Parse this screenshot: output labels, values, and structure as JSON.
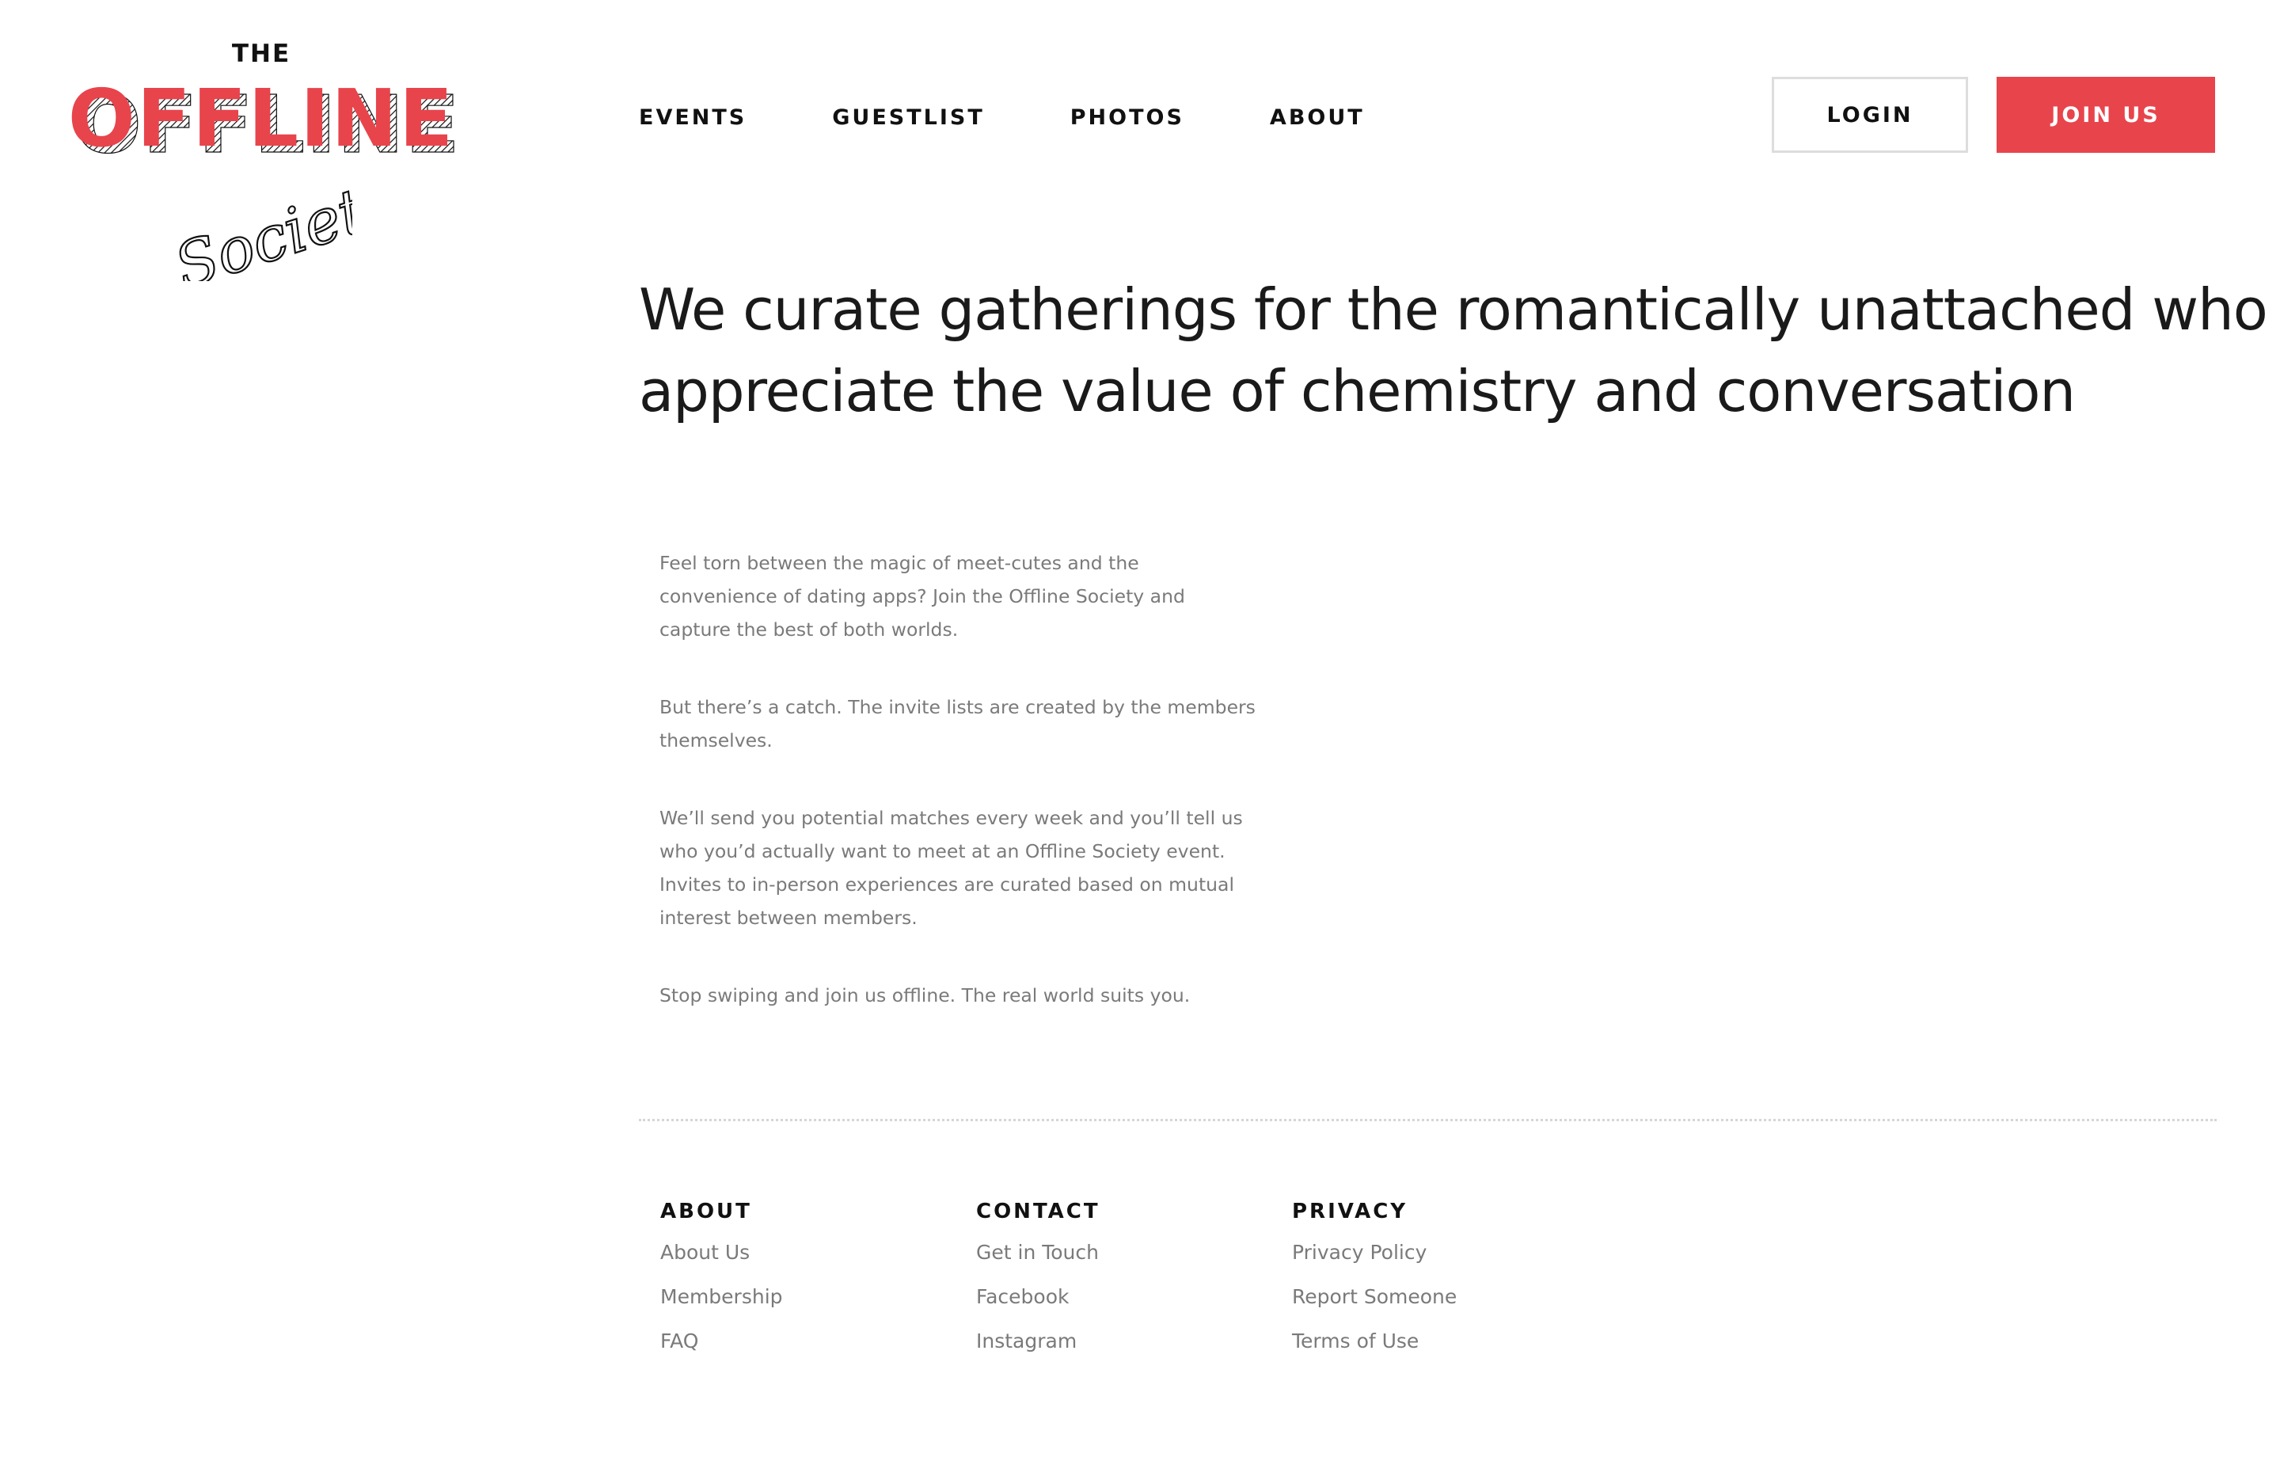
{
  "brand": {
    "logo_top": "THE",
    "logo_main": "OFFLINE",
    "logo_script": "Society",
    "accent_color": "#e8444c"
  },
  "nav": {
    "items": [
      {
        "label": "EVENTS"
      },
      {
        "label": "GUESTLIST"
      },
      {
        "label": "PHOTOS"
      },
      {
        "label": "ABOUT"
      }
    ],
    "login_label": "LOGIN",
    "join_label": "JOIN US"
  },
  "hero": {
    "line1": "We curate gatherings for the romantically unattached who",
    "line2": "appreciate the value of chemistry and conversation"
  },
  "body": {
    "paragraphs": [
      "Feel torn between the magic of meet-cutes and the convenience of dating apps? Join the Offline Society and capture the best of both worlds.",
      "But there’s a catch. The invite lists are created by the members themselves.",
      "We’ll send you potential matches every week and you’ll tell us who you’d actually want to meet at an Offline Society event. Invites to in-person experiences are curated based on mutual interest between members.",
      "Stop swiping and join us offline. The real world suits you."
    ]
  },
  "footer": {
    "columns": [
      {
        "heading": "ABOUT",
        "links": [
          "About Us",
          "Membership",
          "FAQ"
        ]
      },
      {
        "heading": "CONTACT",
        "links": [
          "Get in Touch",
          "Facebook",
          "Instagram"
        ]
      },
      {
        "heading": "PRIVACY",
        "links": [
          "Privacy Policy",
          "Report Someone",
          "Terms of Use"
        ]
      }
    ]
  }
}
